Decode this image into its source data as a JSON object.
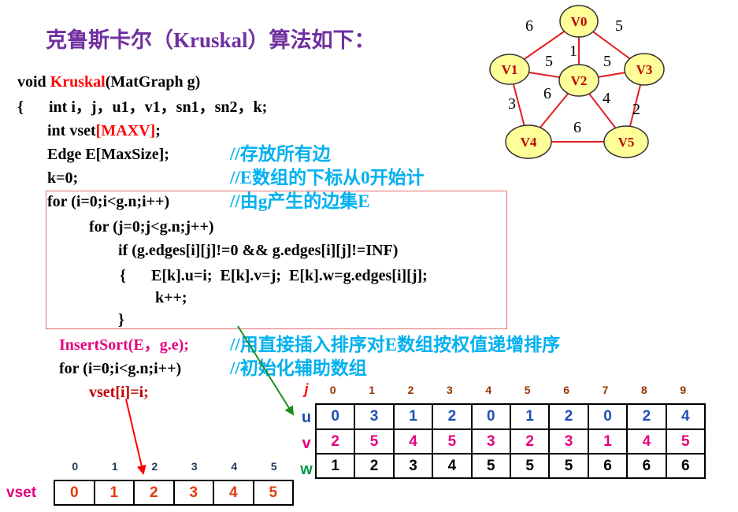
{
  "title": "克鲁斯卡尔（Kruskal）算法如下：",
  "code": {
    "line1": {
      "pre": "void ",
      "name": "Kruskal",
      "post": "(MatGraph g)"
    },
    "line2": {
      "brace": "{",
      "text": "int i，j，u1，v1，sn1，sn2，k;"
    },
    "line3": {
      "pre": "int vset",
      "hl": "[MAXV]",
      "post": ";"
    },
    "line4": "Edge E[MaxSize];",
    "line5": "k=0;",
    "line6": "for (i=0;i<g.n;i++)",
    "line7": "for (j=0;j<g.n;j++)",
    "line8": "if (g.edges[i][j]!=0 && g.edges[i][j]!=INF)",
    "line9": {
      "brace": "{",
      "text": "E[k].u=i;  E[k].v=j;  E[k].w=g.edges[i][j];"
    },
    "line10": "k++;",
    "line11": "}",
    "line12": "InsertSort(E，g.e);",
    "line13": "for (i=0;i<g.n;i++)",
    "line14": "vset[i]=i;"
  },
  "comments": {
    "line4": "//存放所有边",
    "line5": "//E数组的下标从0开始计",
    "line6": "//由g产生的边集E",
    "line12": "//用直接插入排序对E数组按权值递增排序",
    "line13": "//初始化辅助数组"
  },
  "graph": {
    "nodes": [
      "V0",
      "V1",
      "V2",
      "V3",
      "V4",
      "V5"
    ],
    "edges": [
      {
        "from": "V0",
        "to": "V1",
        "weight": "6"
      },
      {
        "from": "V0",
        "to": "V3",
        "weight": "5"
      },
      {
        "from": "V0",
        "to": "V2",
        "weight": "1"
      },
      {
        "from": "V1",
        "to": "V2",
        "weight": "5"
      },
      {
        "from": "V2",
        "to": "V3",
        "weight": "5"
      },
      {
        "from": "V1",
        "to": "V4",
        "weight": "3"
      },
      {
        "from": "V2",
        "to": "V4",
        "weight": "6"
      },
      {
        "from": "V2",
        "to": "V5",
        "weight": "4"
      },
      {
        "from": "V3",
        "to": "V5",
        "weight": "2"
      },
      {
        "from": "V4",
        "to": "V5",
        "weight": "6"
      }
    ]
  },
  "edge_table": {
    "index_label": "j",
    "indices": [
      "0",
      "1",
      "2",
      "3",
      "4",
      "5",
      "6",
      "7",
      "8",
      "9"
    ],
    "rows": [
      {
        "label": "u",
        "values": [
          "0",
          "3",
          "1",
          "2",
          "0",
          "1",
          "2",
          "0",
          "2",
          "4"
        ]
      },
      {
        "label": "v",
        "values": [
          "2",
          "5",
          "4",
          "5",
          "3",
          "2",
          "3",
          "1",
          "4",
          "5"
        ]
      },
      {
        "label": "w",
        "values": [
          "1",
          "2",
          "3",
          "4",
          "5",
          "5",
          "5",
          "6",
          "6",
          "6"
        ]
      }
    ]
  },
  "vset_array": {
    "label": "vset",
    "indices": [
      "0",
      "1",
      "2",
      "3",
      "4",
      "5"
    ],
    "values": [
      "0",
      "1",
      "2",
      "3",
      "4",
      "5"
    ]
  },
  "colors": {
    "title": "#7030A0",
    "comment": "#00B0F0",
    "function_name": "#FF0000",
    "insert_sort": "#E4007F",
    "loop_box": "#E46C6C",
    "graph_edge": "#E02020",
    "graph_node_fill": "#FFFF99",
    "u_row": "#1F4FB4",
    "v_row": "#E4007F",
    "w_label": "#009944",
    "vset_values": "#E8380D"
  }
}
